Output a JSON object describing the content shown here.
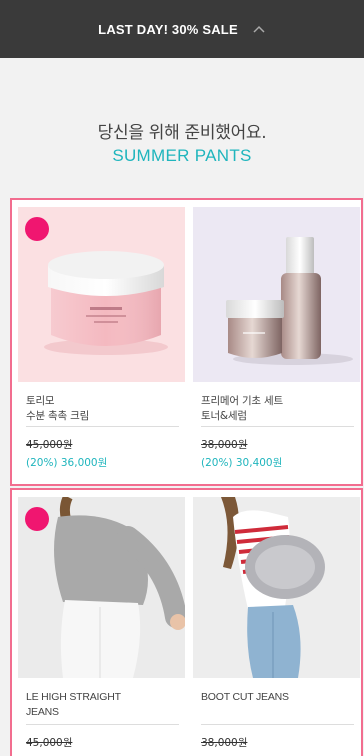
{
  "banner": {
    "text": "LAST DAY! 30% SALE",
    "icon": "chevron-up-icon"
  },
  "hero": {
    "line1": "당신을 위해 준비했어요.",
    "line2": "SUMMER PANTS"
  },
  "colors": {
    "accent": "#1fb5bd",
    "section_border": "#f26d8f",
    "dot": "#f01670",
    "banner_bg": "#3a3a3a"
  },
  "products": [
    {
      "name1": "토리모",
      "name2": "수분 촉촉 크림",
      "price": "45,000원",
      "sale": "(20%) 36,000원"
    },
    {
      "name1": "프리메어 기초 세트",
      "name2": "토너&세럼",
      "price": "38,000원",
      "sale": "(20%) 30,400원"
    },
    {
      "name1": "LE HIGH STRAIGHT",
      "name2": "JEANS",
      "price": "45,000원"
    },
    {
      "name1": "BOOT CUT JEANS",
      "name2": "",
      "price": "38,000원"
    }
  ]
}
